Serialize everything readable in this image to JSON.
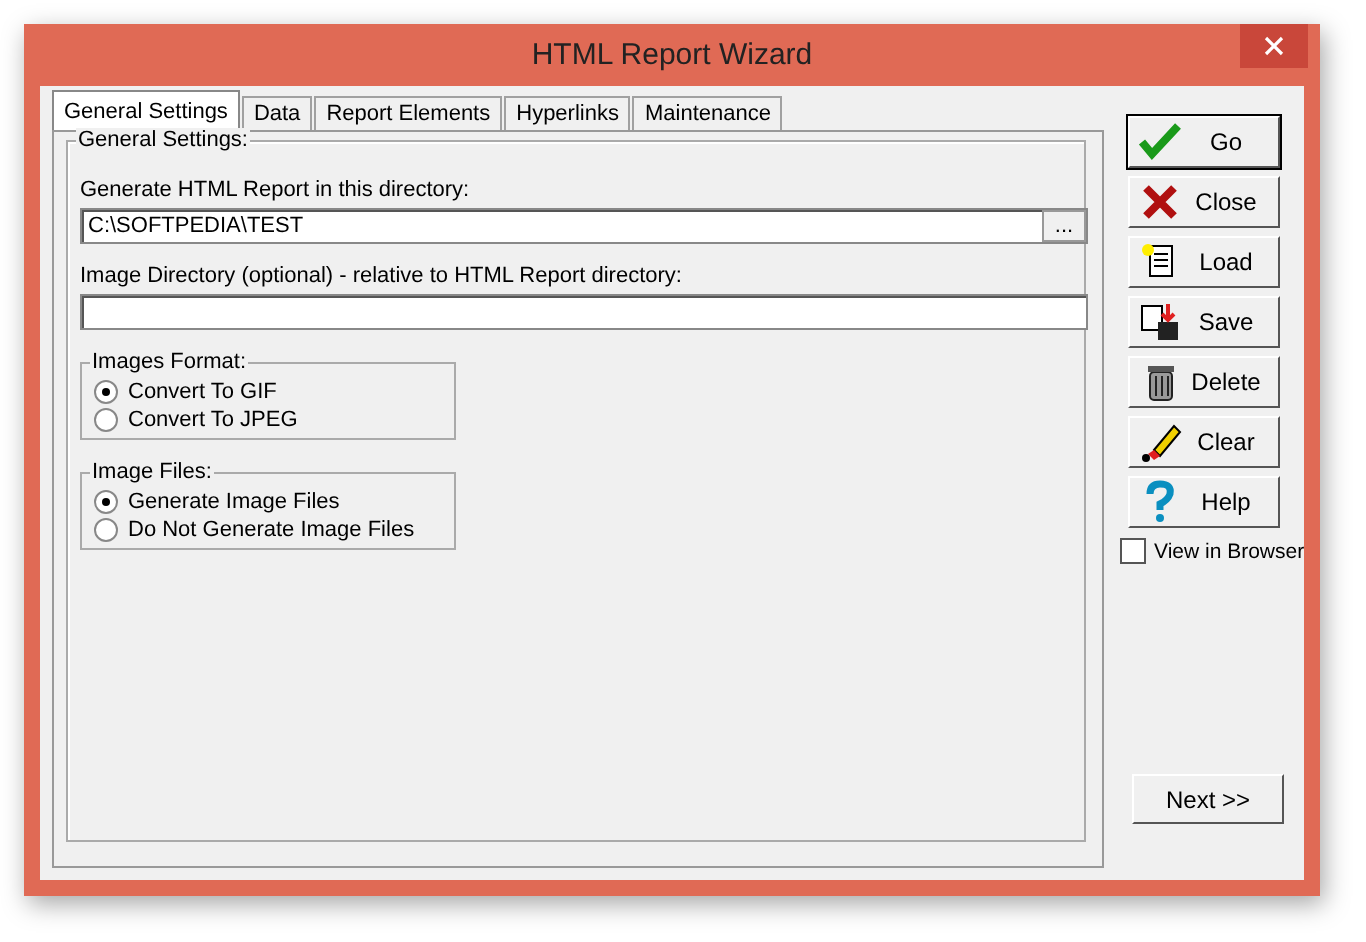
{
  "window": {
    "title": "HTML Report Wizard"
  },
  "tabs": [
    {
      "label": "General Settings",
      "selected": true
    },
    {
      "label": "Data",
      "selected": false
    },
    {
      "label": "Report Elements",
      "selected": false
    },
    {
      "label": "Hyperlinks",
      "selected": false
    },
    {
      "label": "Maintenance",
      "selected": false
    }
  ],
  "general_settings": {
    "legend": "General Settings:",
    "report_directory": {
      "label": "Generate HTML Report in this directory:",
      "value": "C:\\SOFTPEDIA\\TEST",
      "browse": "..."
    },
    "image_directory": {
      "label": "Image Directory (optional) - relative to HTML Report directory:"
    },
    "groups": [
      {
        "legend": "Images Format:",
        "options": [
          {
            "label": "Convert To GIF",
            "selected": true
          },
          {
            "label": "Convert To JPEG",
            "selected": false
          }
        ]
      },
      {
        "legend": "Image Files:",
        "options": [
          {
            "label": "Generate Image Files",
            "selected": true
          },
          {
            "label": "Do Not Generate Image Files",
            "selected": false
          }
        ]
      }
    ]
  },
  "actions": [
    {
      "kind": "go",
      "label": "Go"
    },
    {
      "kind": "close",
      "label": "Close"
    },
    {
      "kind": "load",
      "label": "Load"
    },
    {
      "kind": "save",
      "label": "Save"
    },
    {
      "kind": "delete",
      "label": "Delete"
    },
    {
      "kind": "clear",
      "label": "Clear"
    },
    {
      "kind": "help",
      "label": "Help"
    }
  ],
  "view_in_browser": {
    "label": "View in Browser",
    "checked": false
  },
  "next_button": "Next >>"
}
